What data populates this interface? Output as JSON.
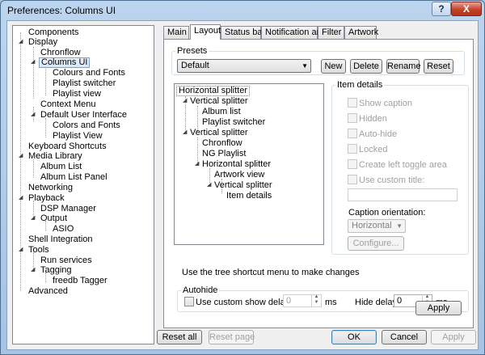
{
  "window": {
    "title": "Preferences: Columns UI",
    "help_glyph": "?",
    "close_glyph": "X"
  },
  "tree": {
    "items": [
      {
        "label": "Components"
      },
      {
        "label": "Display"
      },
      {
        "label": "Chronflow"
      },
      {
        "label": "Columns UI",
        "selected": true
      },
      {
        "label": "Colours and Fonts"
      },
      {
        "label": "Playlist switcher"
      },
      {
        "label": "Playlist view"
      },
      {
        "label": "Context Menu"
      },
      {
        "label": "Default User Interface"
      },
      {
        "label": "Colors and Fonts"
      },
      {
        "label": "Playlist View"
      },
      {
        "label": "Keyboard Shortcuts"
      },
      {
        "label": "Media Library"
      },
      {
        "label": "Album List"
      },
      {
        "label": "Album List Panel"
      },
      {
        "label": "Networking"
      },
      {
        "label": "Playback"
      },
      {
        "label": "DSP Manager"
      },
      {
        "label": "Output"
      },
      {
        "label": "ASIO"
      },
      {
        "label": "Shell Integration"
      },
      {
        "label": "Tools"
      },
      {
        "label": "Run services"
      },
      {
        "label": "Tagging"
      },
      {
        "label": "freedb Tagger"
      },
      {
        "label": "Advanced"
      }
    ]
  },
  "tabs": [
    {
      "label": "Main"
    },
    {
      "label": "Layout",
      "active": true
    },
    {
      "label": "Status bar"
    },
    {
      "label": "Notification area"
    },
    {
      "label": "Filter"
    },
    {
      "label": "Artwork"
    }
  ],
  "presets": {
    "group_label": "Presets",
    "selected": "Default",
    "new_label": "New",
    "delete_label": "Delete",
    "rename_label": "Rename",
    "reset_label": "Reset"
  },
  "layout_tree": {
    "items": [
      {
        "label": "Horizontal splitter"
      },
      {
        "label": "Vertical splitter"
      },
      {
        "label": "Album list"
      },
      {
        "label": "Playlist switcher"
      },
      {
        "label": "Vertical splitter"
      },
      {
        "label": "Chronflow"
      },
      {
        "label": "NG Playlist"
      },
      {
        "label": "Horizontal splitter"
      },
      {
        "label": "Artwork view"
      },
      {
        "label": "Vertical splitter"
      },
      {
        "label": "Item details"
      }
    ],
    "hint": "Use the tree shortcut menu to make changes"
  },
  "item_details": {
    "group_label": "Item details",
    "show_caption": "Show caption",
    "hidden": "Hidden",
    "auto_hide": "Auto-hide",
    "locked": "Locked",
    "create_toggle": "Create left toggle area",
    "use_custom_title": "Use custom title:",
    "custom_title_value": "",
    "caption_orientation_label": "Caption orientation:",
    "caption_orientation_value": "Horizontal",
    "configure_label": "Configure..."
  },
  "autohide": {
    "group_label": "Autohide",
    "use_custom_delay": "Use custom show delay of",
    "show_delay_value": "0",
    "ms_1": "ms",
    "hide_delay_label": "Hide delay:",
    "hide_delay_value": "0",
    "ms_2": "ms"
  },
  "apply_tab_label": "Apply",
  "footer": {
    "reset_all": "Reset all",
    "reset_page": "Reset page",
    "ok": "OK",
    "cancel": "Cancel",
    "apply": "Apply"
  }
}
